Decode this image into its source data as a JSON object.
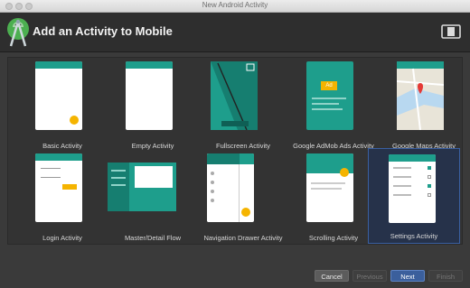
{
  "window": {
    "title": "New Android Activity"
  },
  "header": {
    "title": "Add an Activity to Mobile"
  },
  "activities": [
    {
      "label": "Basic Activity"
    },
    {
      "label": "Empty Activity"
    },
    {
      "label": "Fullscreen Activity"
    },
    {
      "label": "Google AdMob Ads Activity"
    },
    {
      "label": "Google Maps Activity"
    },
    {
      "label": "Login Activity"
    },
    {
      "label": "Master/Detail Flow"
    },
    {
      "label": "Navigation Drawer Activity"
    },
    {
      "label": "Scrolling Activity"
    },
    {
      "label": "Settings Activity",
      "selected": true
    }
  ],
  "ad_badge": "Ad",
  "footer": {
    "cancel_label": "Cancel",
    "previous_label": "Previous",
    "next_label": "Next",
    "finish_label": "Finish"
  },
  "colors": {
    "teal": "#1e9e8c",
    "accent": "#f5b400",
    "selection": "#3a5fa0"
  }
}
